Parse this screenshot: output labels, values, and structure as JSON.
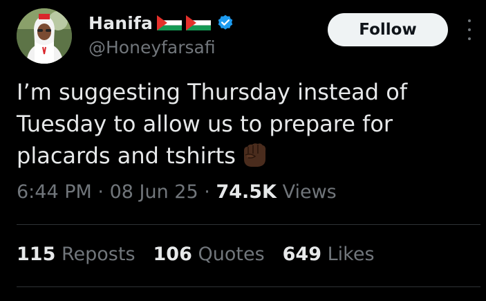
{
  "author": {
    "display_name": "Hanifa",
    "handle": "@Honeyfarsafi",
    "flags": [
      "palestine-flag",
      "palestine-flag"
    ],
    "verified_badge": "verified-badge-icon"
  },
  "actions": {
    "follow_label": "Follow",
    "more_icon": "more-options-icon"
  },
  "tweet": {
    "text": "I’m suggesting Thursday instead of Tuesday to allow us to prepare for placards and tshirts",
    "emoji": "raised-fist-dark-skin-tone"
  },
  "meta": {
    "time": "6:44 PM",
    "date": "08 Jun 25",
    "views_count": "74.5K",
    "views_label": "Views"
  },
  "stats": {
    "reposts_count": "115",
    "reposts_label": "Reposts",
    "quotes_count": "106",
    "quotes_label": "Quotes",
    "likes_count": "649",
    "likes_label": "Likes"
  },
  "colors": {
    "background": "#000000",
    "primary_text": "#e7e9ea",
    "secondary_text": "#71767b",
    "verified_blue": "#1d9bf0",
    "divider": "#2f3336",
    "follow_bg": "#eff3f4"
  }
}
